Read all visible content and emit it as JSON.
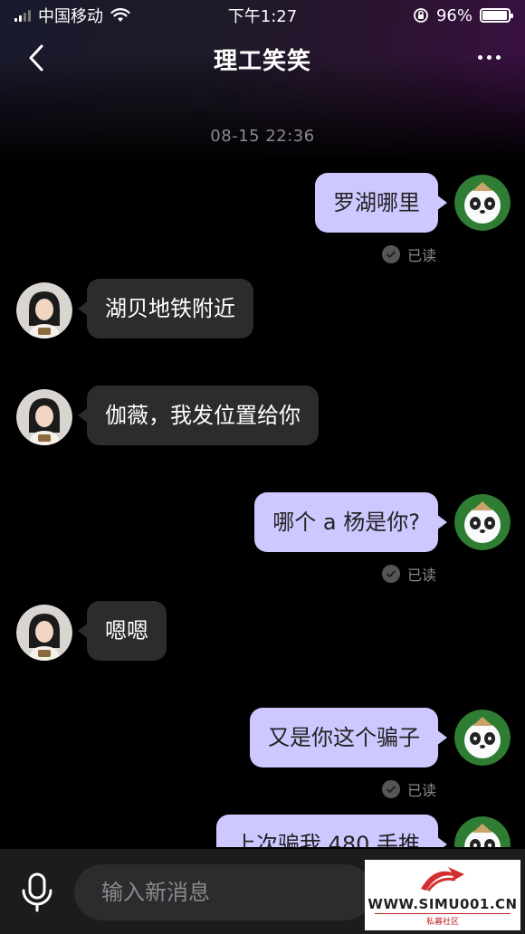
{
  "status_bar": {
    "carrier": "中国移动",
    "time": "下午1:27",
    "battery": "96%",
    "battery_level": 0.96
  },
  "header": {
    "title": "理工笑笑",
    "back_icon": "chevron-left-icon",
    "more_icon": "more-dots-icon"
  },
  "chat": {
    "timestamp": "08-15  22:36",
    "messages": [
      {
        "side": "out",
        "text": "罗湖哪里",
        "read": "已读"
      },
      {
        "side": "in",
        "text": "湖贝地铁附近"
      },
      {
        "side": "in",
        "text": "伽薇，我发位置给你"
      },
      {
        "side": "out",
        "text": "哪个 a 杨是你?",
        "read": "已读"
      },
      {
        "side": "in",
        "text": "嗯嗯"
      },
      {
        "side": "out",
        "text": "又是你这个骗子",
        "read": "已读"
      },
      {
        "side": "out",
        "text": "上次骗我 480 手推"
      }
    ]
  },
  "input_bar": {
    "placeholder": "输入新消息",
    "mic_icon": "microphone-icon"
  },
  "watermark": {
    "text": "WWW.SIMU001.CN",
    "subtext": "私募社区"
  },
  "colors": {
    "outgoing_bubble": "#cdc8ff",
    "incoming_bubble": "#2c2c2e",
    "background": "#000000"
  }
}
